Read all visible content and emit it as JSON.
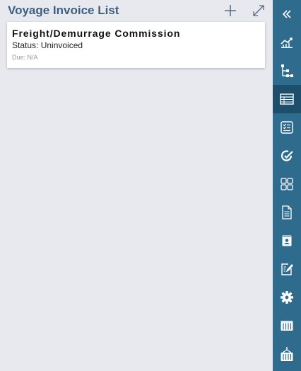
{
  "header": {
    "title": "Voyage Invoice List",
    "add_icon": "plus-icon",
    "expand_icon": "expand-icon"
  },
  "invoices": [
    {
      "title": "Freight/Demurrage Commission",
      "status": "Status: Uninvoiced",
      "due": "Due: N/A"
    }
  ],
  "rail": {
    "items": [
      {
        "icon": "collapse-icon",
        "active": false
      },
      {
        "icon": "chart-icon",
        "active": false
      },
      {
        "icon": "hierarchy-icon",
        "active": false
      },
      {
        "icon": "table-icon",
        "active": true
      },
      {
        "icon": "checklist-icon",
        "active": false
      },
      {
        "icon": "refresh-check-icon",
        "active": false
      },
      {
        "icon": "grid-icon",
        "active": false
      },
      {
        "icon": "document-icon",
        "active": false
      },
      {
        "icon": "contact-icon",
        "active": false
      },
      {
        "icon": "edit-icon",
        "active": false
      },
      {
        "icon": "gear-icon",
        "active": false
      },
      {
        "icon": "container-icon",
        "active": false
      },
      {
        "icon": "crane-container-icon",
        "active": false
      }
    ]
  },
  "colors": {
    "background": "#e8e8ef",
    "title": "#3e5f7f",
    "rail": "#2f6b8d",
    "rail_active": "#1d4e6c"
  }
}
